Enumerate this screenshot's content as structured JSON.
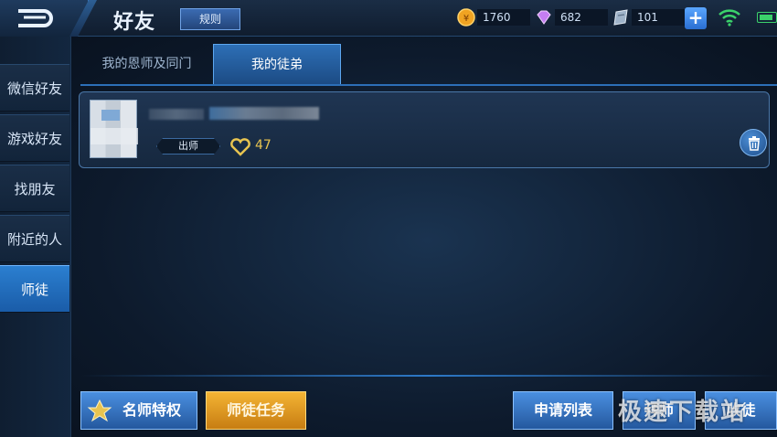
{
  "header": {
    "title": "好友",
    "rules_label": "规则"
  },
  "currencies": [
    {
      "icon": "gold-coin-icon",
      "value": "1760"
    },
    {
      "icon": "diamond-icon",
      "value": "682"
    },
    {
      "icon": "voucher-icon",
      "value": "101"
    }
  ],
  "status": {
    "wifi": "wifi-icon",
    "battery": "battery-icon"
  },
  "sidebar": {
    "items": [
      {
        "label": "微信好友"
      },
      {
        "label": "游戏好友"
      },
      {
        "label": "找朋友"
      },
      {
        "label": "附近的人"
      },
      {
        "label": "师徒",
        "active": true
      }
    ]
  },
  "tabs": [
    {
      "label": "我的恩师及同门"
    },
    {
      "label": "我的徒弟",
      "active": true
    }
  ],
  "apprentices": [
    {
      "badge": "出师",
      "likes": "47"
    }
  ],
  "bottom": {
    "famous_master_label": "名师特权",
    "tasks_label": "师徒任务",
    "applications_label": "申请列表",
    "find_master_label": "拜师",
    "take_apprentice_label": "收徒"
  },
  "watermark": "极速下载站",
  "colors": {
    "accent_blue": "#2b7fd0",
    "gold": "#f4b434",
    "likes": "#e8c450"
  }
}
